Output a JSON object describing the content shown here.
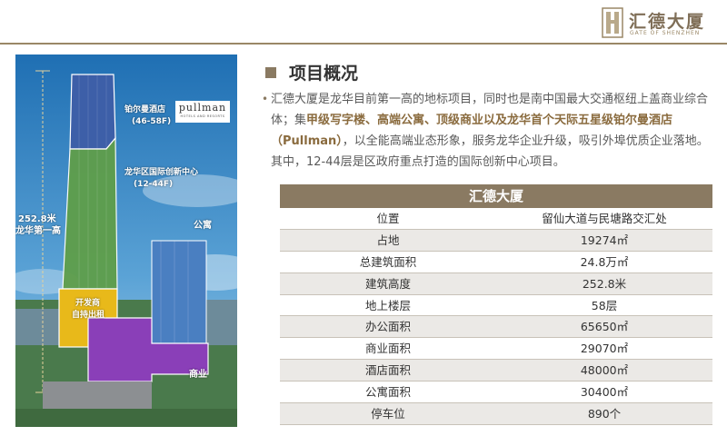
{
  "brand": {
    "name": "汇德大厦",
    "subtitle": "GATE OF SHENZHEN"
  },
  "photo": {
    "hotel_tag": "铂尔曼酒店",
    "hotel_floors": "(46-58F)",
    "pullman_logo": "pullman",
    "pullman_logo_sub": "HOTELS AND RESORTS",
    "innovation_tag": "龙华区国际创新中心",
    "innovation_floors": "(12-44F)",
    "height_value": "252.8米",
    "height_note": "龙华第一高",
    "apartment_tag": "公寓",
    "developer_tag_1": "开发商",
    "developer_tag_2": "自持出租",
    "commercial_tag": "商业"
  },
  "section": {
    "title": "项目概况"
  },
  "intro": {
    "part1": "汇德大厦是龙华目前第一高的地标项目，同时也是南中国最大交通枢纽上盖商业综合体；集",
    "highlight": "甲级写字楼、高端公寓、顶级商业以及龙华首个天际五星级铂尔曼酒店（Pullman）",
    "part2": "，以全能高端业态形象，服务龙华企业升级，吸引外埠优质企业落地。其中，12-44层是区政府重点打造的国际创新中心项目。"
  },
  "table": {
    "title": "汇德大厦",
    "rows": [
      {
        "label": "位置",
        "value": "留仙大道与民塘路交汇处"
      },
      {
        "label": "占地",
        "value": "19274㎡"
      },
      {
        "label": "总建筑面积",
        "value": "24.8万㎡"
      },
      {
        "label": "建筑高度",
        "value": "252.8米"
      },
      {
        "label": "地上楼层",
        "value": "58层"
      },
      {
        "label": "办公面积",
        "value": "65650㎡"
      },
      {
        "label": "商业面积",
        "value": "29070㎡"
      },
      {
        "label": "酒店面积",
        "value": "48000㎡"
      },
      {
        "label": "公寓面积",
        "value": "30400㎡"
      },
      {
        "label": "停车位",
        "value": "890个"
      }
    ]
  }
}
